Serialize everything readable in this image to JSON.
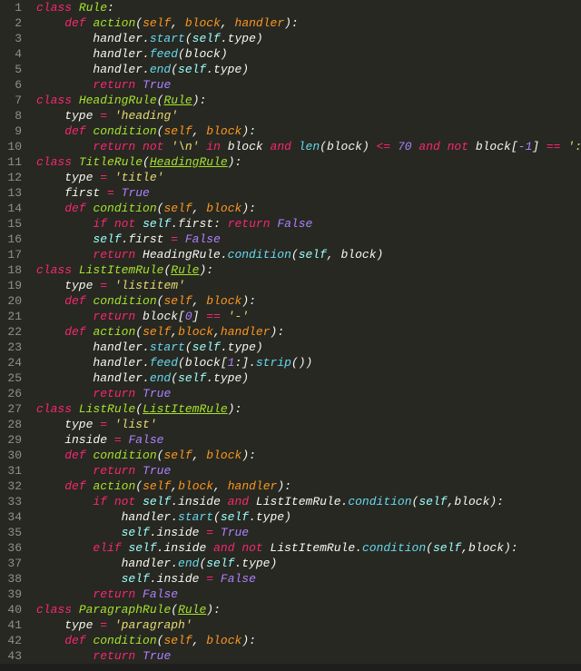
{
  "lines": [
    [
      [
        "kw",
        "class"
      ],
      [
        "p",
        " "
      ],
      [
        "cls",
        "Rule"
      ],
      [
        "p",
        ":"
      ]
    ],
    [
      [
        "p",
        "    "
      ],
      [
        "kw",
        "def"
      ],
      [
        "p",
        " "
      ],
      [
        "fn",
        "action"
      ],
      [
        "p",
        "("
      ],
      [
        "prm",
        "self"
      ],
      [
        "p",
        ", "
      ],
      [
        "prm",
        "block"
      ],
      [
        "p",
        ", "
      ],
      [
        "prm",
        "handler"
      ],
      [
        "p",
        "):"
      ]
    ],
    [
      [
        "p",
        "        handler."
      ],
      [
        "call",
        "start"
      ],
      [
        "p",
        "("
      ],
      [
        "self",
        "self"
      ],
      [
        "p",
        ".type)"
      ]
    ],
    [
      [
        "p",
        "        handler."
      ],
      [
        "call",
        "feed"
      ],
      [
        "p",
        "(block)"
      ]
    ],
    [
      [
        "p",
        "        handler."
      ],
      [
        "call",
        "end"
      ],
      [
        "p",
        "("
      ],
      [
        "self",
        "self"
      ],
      [
        "p",
        ".type)"
      ]
    ],
    [
      [
        "p",
        "        "
      ],
      [
        "kw",
        "return"
      ],
      [
        "p",
        " "
      ],
      [
        "val",
        "True"
      ]
    ],
    [
      [
        "kw",
        "class"
      ],
      [
        "p",
        " "
      ],
      [
        "cls",
        "HeadingRule"
      ],
      [
        "p",
        "("
      ],
      [
        "base",
        "Rule"
      ],
      [
        "p",
        "):"
      ]
    ],
    [
      [
        "p",
        "    type "
      ],
      [
        "op",
        "="
      ],
      [
        "p",
        " "
      ],
      [
        "str",
        "'heading'"
      ]
    ],
    [
      [
        "p",
        "    "
      ],
      [
        "kw",
        "def"
      ],
      [
        "p",
        " "
      ],
      [
        "fn",
        "condition"
      ],
      [
        "p",
        "("
      ],
      [
        "prm",
        "self"
      ],
      [
        "p",
        ", "
      ],
      [
        "prm",
        "block"
      ],
      [
        "p",
        "):"
      ]
    ],
    [
      [
        "p",
        "        "
      ],
      [
        "kw",
        "return"
      ],
      [
        "p",
        " "
      ],
      [
        "op",
        "not"
      ],
      [
        "p",
        " "
      ],
      [
        "str",
        "'\\n'"
      ],
      [
        "p",
        " "
      ],
      [
        "op",
        "in"
      ],
      [
        "p",
        " block "
      ],
      [
        "op",
        "and"
      ],
      [
        "p",
        " "
      ],
      [
        "call",
        "len"
      ],
      [
        "p",
        "(block) "
      ],
      [
        "op",
        "<="
      ],
      [
        "p",
        " "
      ],
      [
        "num",
        "70"
      ],
      [
        "p",
        " "
      ],
      [
        "op",
        "and"
      ],
      [
        "p",
        " "
      ],
      [
        "op",
        "not"
      ],
      [
        "p",
        " block["
      ],
      [
        "num",
        "-1"
      ],
      [
        "p",
        "] "
      ],
      [
        "op",
        "=="
      ],
      [
        "p",
        " "
      ],
      [
        "str",
        "':'"
      ]
    ],
    [
      [
        "kw",
        "class"
      ],
      [
        "p",
        " "
      ],
      [
        "cls",
        "TitleRule"
      ],
      [
        "p",
        "("
      ],
      [
        "base",
        "HeadingRule"
      ],
      [
        "p",
        "):"
      ]
    ],
    [
      [
        "p",
        "    type "
      ],
      [
        "op",
        "="
      ],
      [
        "p",
        " "
      ],
      [
        "str",
        "'title'"
      ]
    ],
    [
      [
        "p",
        "    first "
      ],
      [
        "op",
        "="
      ],
      [
        "p",
        " "
      ],
      [
        "val",
        "True"
      ]
    ],
    [
      [
        "p",
        "    "
      ],
      [
        "kw",
        "def"
      ],
      [
        "p",
        " "
      ],
      [
        "fn",
        "condition"
      ],
      [
        "p",
        "("
      ],
      [
        "prm",
        "self"
      ],
      [
        "p",
        ", "
      ],
      [
        "prm",
        "block"
      ],
      [
        "p",
        "):"
      ]
    ],
    [
      [
        "p",
        "        "
      ],
      [
        "kw",
        "if"
      ],
      [
        "p",
        " "
      ],
      [
        "op",
        "not"
      ],
      [
        "p",
        " "
      ],
      [
        "self",
        "self"
      ],
      [
        "p",
        ".first: "
      ],
      [
        "kw",
        "return"
      ],
      [
        "p",
        " "
      ],
      [
        "val",
        "False"
      ]
    ],
    [
      [
        "p",
        "        "
      ],
      [
        "self",
        "self"
      ],
      [
        "p",
        ".first "
      ],
      [
        "op",
        "="
      ],
      [
        "p",
        " "
      ],
      [
        "val",
        "False"
      ]
    ],
    [
      [
        "p",
        "        "
      ],
      [
        "kw",
        "return"
      ],
      [
        "p",
        " HeadingRule."
      ],
      [
        "call",
        "condition"
      ],
      [
        "p",
        "("
      ],
      [
        "self",
        "self"
      ],
      [
        "p",
        ", block)"
      ]
    ],
    [
      [
        "kw",
        "class"
      ],
      [
        "p",
        " "
      ],
      [
        "cls",
        "ListItemRule"
      ],
      [
        "p",
        "("
      ],
      [
        "base",
        "Rule"
      ],
      [
        "p",
        "):"
      ]
    ],
    [
      [
        "p",
        "    type "
      ],
      [
        "op",
        "="
      ],
      [
        "p",
        " "
      ],
      [
        "str",
        "'listitem'"
      ]
    ],
    [
      [
        "p",
        "    "
      ],
      [
        "kw",
        "def"
      ],
      [
        "p",
        " "
      ],
      [
        "fn",
        "condition"
      ],
      [
        "p",
        "("
      ],
      [
        "prm",
        "self"
      ],
      [
        "p",
        ", "
      ],
      [
        "prm",
        "block"
      ],
      [
        "p",
        "):"
      ]
    ],
    [
      [
        "p",
        "        "
      ],
      [
        "kw",
        "return"
      ],
      [
        "p",
        " block["
      ],
      [
        "num",
        "0"
      ],
      [
        "p",
        "] "
      ],
      [
        "op",
        "=="
      ],
      [
        "p",
        " "
      ],
      [
        "str",
        "'-'"
      ]
    ],
    [
      [
        "p",
        "    "
      ],
      [
        "kw",
        "def"
      ],
      [
        "p",
        " "
      ],
      [
        "fn",
        "action"
      ],
      [
        "p",
        "("
      ],
      [
        "prm",
        "self"
      ],
      [
        "p",
        ","
      ],
      [
        "prm",
        "block"
      ],
      [
        "p",
        ","
      ],
      [
        "prm",
        "handler"
      ],
      [
        "p",
        "):"
      ]
    ],
    [
      [
        "p",
        "        handler."
      ],
      [
        "call",
        "start"
      ],
      [
        "p",
        "("
      ],
      [
        "self",
        "self"
      ],
      [
        "p",
        ".type)"
      ]
    ],
    [
      [
        "p",
        "        handler."
      ],
      [
        "call",
        "feed"
      ],
      [
        "p",
        "(block["
      ],
      [
        "num",
        "1"
      ],
      [
        "p",
        ":]."
      ],
      [
        "call",
        "strip"
      ],
      [
        "p",
        "())"
      ]
    ],
    [
      [
        "p",
        "        handler."
      ],
      [
        "call",
        "end"
      ],
      [
        "p",
        "("
      ],
      [
        "self",
        "self"
      ],
      [
        "p",
        ".type)"
      ]
    ],
    [
      [
        "p",
        "        "
      ],
      [
        "kw",
        "return"
      ],
      [
        "p",
        " "
      ],
      [
        "val",
        "True"
      ]
    ],
    [
      [
        "kw",
        "class"
      ],
      [
        "p",
        " "
      ],
      [
        "cls",
        "ListRule"
      ],
      [
        "p",
        "("
      ],
      [
        "base",
        "ListItemRule"
      ],
      [
        "p",
        "):"
      ]
    ],
    [
      [
        "p",
        "    type "
      ],
      [
        "op",
        "="
      ],
      [
        "p",
        " "
      ],
      [
        "str",
        "'list'"
      ]
    ],
    [
      [
        "p",
        "    inside "
      ],
      [
        "op",
        "="
      ],
      [
        "p",
        " "
      ],
      [
        "val",
        "False"
      ]
    ],
    [
      [
        "p",
        "    "
      ],
      [
        "kw",
        "def"
      ],
      [
        "p",
        " "
      ],
      [
        "fn",
        "condition"
      ],
      [
        "p",
        "("
      ],
      [
        "prm",
        "self"
      ],
      [
        "p",
        ", "
      ],
      [
        "prm",
        "block"
      ],
      [
        "p",
        "):"
      ]
    ],
    [
      [
        "p",
        "        "
      ],
      [
        "kw",
        "return"
      ],
      [
        "p",
        " "
      ],
      [
        "val",
        "True"
      ]
    ],
    [
      [
        "p",
        "    "
      ],
      [
        "kw",
        "def"
      ],
      [
        "p",
        " "
      ],
      [
        "fn",
        "action"
      ],
      [
        "p",
        "("
      ],
      [
        "prm",
        "self"
      ],
      [
        "p",
        ","
      ],
      [
        "prm",
        "block"
      ],
      [
        "p",
        ", "
      ],
      [
        "prm",
        "handler"
      ],
      [
        "p",
        "):"
      ]
    ],
    [
      [
        "p",
        "        "
      ],
      [
        "kw",
        "if"
      ],
      [
        "p",
        " "
      ],
      [
        "op",
        "not"
      ],
      [
        "p",
        " "
      ],
      [
        "self",
        "self"
      ],
      [
        "p",
        ".inside "
      ],
      [
        "op",
        "and"
      ],
      [
        "p",
        " ListItemRule."
      ],
      [
        "call",
        "condition"
      ],
      [
        "p",
        "("
      ],
      [
        "self",
        "self"
      ],
      [
        "p",
        ",block):"
      ]
    ],
    [
      [
        "p",
        "            handler."
      ],
      [
        "call",
        "start"
      ],
      [
        "p",
        "("
      ],
      [
        "self",
        "self"
      ],
      [
        "p",
        ".type)"
      ]
    ],
    [
      [
        "p",
        "            "
      ],
      [
        "self",
        "self"
      ],
      [
        "p",
        ".inside "
      ],
      [
        "op",
        "="
      ],
      [
        "p",
        " "
      ],
      [
        "val",
        "True"
      ]
    ],
    [
      [
        "p",
        "        "
      ],
      [
        "kw",
        "elif"
      ],
      [
        "p",
        " "
      ],
      [
        "self",
        "self"
      ],
      [
        "p",
        ".inside "
      ],
      [
        "op",
        "and"
      ],
      [
        "p",
        " "
      ],
      [
        "op",
        "not"
      ],
      [
        "p",
        " ListItemRule."
      ],
      [
        "call",
        "condition"
      ],
      [
        "p",
        "("
      ],
      [
        "self",
        "self"
      ],
      [
        "p",
        ",block):"
      ]
    ],
    [
      [
        "p",
        "            handler."
      ],
      [
        "call",
        "end"
      ],
      [
        "p",
        "("
      ],
      [
        "self",
        "self"
      ],
      [
        "p",
        ".type)"
      ]
    ],
    [
      [
        "p",
        "            "
      ],
      [
        "self",
        "self"
      ],
      [
        "p",
        ".inside "
      ],
      [
        "op",
        "="
      ],
      [
        "p",
        " "
      ],
      [
        "val",
        "False"
      ]
    ],
    [
      [
        "p",
        "        "
      ],
      [
        "kw",
        "return"
      ],
      [
        "p",
        " "
      ],
      [
        "val",
        "False"
      ]
    ],
    [
      [
        "kw",
        "class"
      ],
      [
        "p",
        " "
      ],
      [
        "cls",
        "ParagraphRule"
      ],
      [
        "p",
        "("
      ],
      [
        "base",
        "Rule"
      ],
      [
        "p",
        "):"
      ]
    ],
    [
      [
        "p",
        "    type "
      ],
      [
        "op",
        "="
      ],
      [
        "p",
        " "
      ],
      [
        "str",
        "'paragraph'"
      ]
    ],
    [
      [
        "p",
        "    "
      ],
      [
        "kw",
        "def"
      ],
      [
        "p",
        " "
      ],
      [
        "fn",
        "condition"
      ],
      [
        "p",
        "("
      ],
      [
        "prm",
        "self"
      ],
      [
        "p",
        ", "
      ],
      [
        "prm",
        "block"
      ],
      [
        "p",
        "):"
      ]
    ],
    [
      [
        "p",
        "        "
      ],
      [
        "kw",
        "return"
      ],
      [
        "p",
        " "
      ],
      [
        "val",
        "True"
      ]
    ]
  ]
}
